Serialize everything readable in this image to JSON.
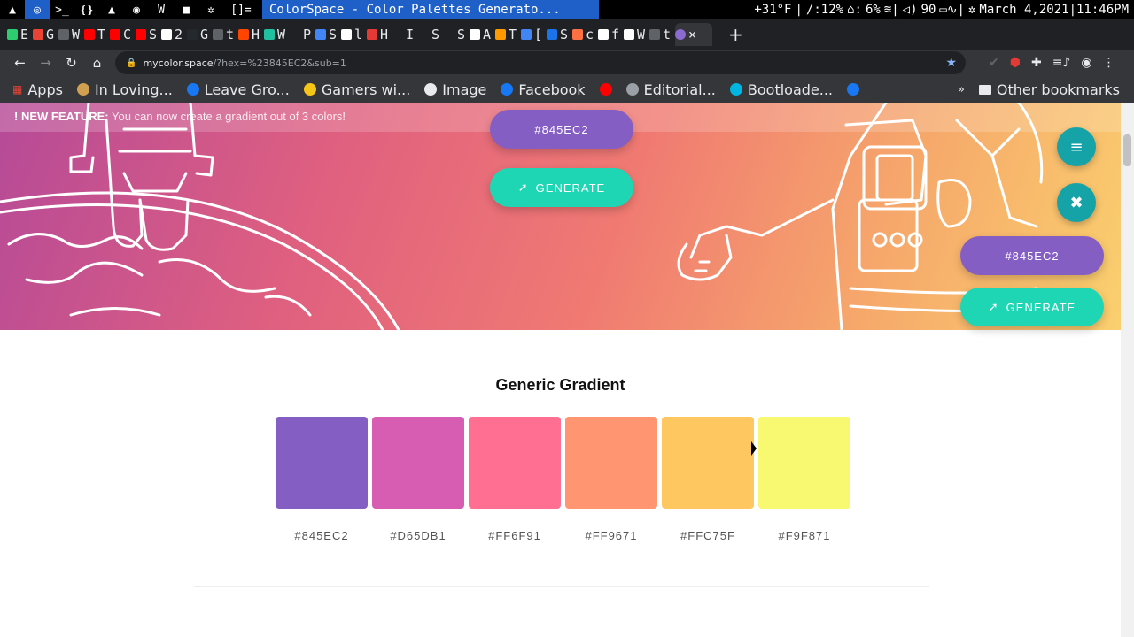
{
  "system_bar": {
    "window_title": "ColorSpace - Color Palettes Generato...",
    "workspace_label": "[]=",
    "temperature": "+31°F",
    "cpu": "/:12%",
    "home_disk": "6%",
    "volume": "90",
    "datetime": "March 4,2021|11:46PM"
  },
  "tabs": [
    {
      "letter": "E",
      "color": "#2ecc71"
    },
    {
      "letter": "G",
      "color": "#ea4335"
    },
    {
      "letter": "W",
      "color": "#5f6368"
    },
    {
      "letter": "T",
      "color": "#ff0000"
    },
    {
      "letter": "C",
      "color": "#ff0000"
    },
    {
      "letter": "S",
      "color": "#ff0000"
    },
    {
      "letter": "2",
      "color": "#ffffff"
    },
    {
      "letter": "G",
      "color": "#24292e"
    },
    {
      "letter": "t",
      "color": "#5f6368"
    },
    {
      "letter": "H",
      "color": "#ff4500"
    },
    {
      "letter": "W",
      "color": "#1fbfa0"
    },
    {
      "letter": "P",
      "color": "#202124"
    },
    {
      "letter": "S",
      "color": "#4285f4"
    },
    {
      "letter": "l",
      "color": "#ffffff"
    },
    {
      "letter": "H",
      "color": "#e53935"
    },
    {
      "letter": "I",
      "color": "#202124"
    },
    {
      "letter": "S",
      "color": "#202124"
    },
    {
      "letter": "S",
      "color": "#202124"
    },
    {
      "letter": "A",
      "color": "#ffffff"
    },
    {
      "letter": "T",
      "color": "#ff9900"
    },
    {
      "letter": "[",
      "color": "#4285f4"
    },
    {
      "letter": "S",
      "color": "#1a73e8"
    },
    {
      "letter": "c",
      "color": "#ff7043"
    },
    {
      "letter": "f",
      "color": "#ffffff"
    },
    {
      "letter": "W",
      "color": "#ffffff"
    },
    {
      "letter": "t",
      "color": "#5f6368"
    }
  ],
  "toolbar": {
    "url_host": "mycolor.space",
    "url_path": "/?hex=%23845EC2&sub=1"
  },
  "bookmarks": {
    "apps": "Apps",
    "items": [
      {
        "label": "In Loving...",
        "color": "#d0a050"
      },
      {
        "label": "Leave Gro...",
        "color": "#1877f2"
      },
      {
        "label": "Gamers wi...",
        "color": "#f5c518"
      },
      {
        "label": "Image",
        "color": "#e8eaed"
      },
      {
        "label": "Facebook",
        "color": "#1877f2"
      },
      {
        "label": "",
        "color": "#ff0000"
      },
      {
        "label": "Editorial...",
        "color": "#9aa0a6"
      },
      {
        "label": "Bootloade...",
        "color": "#00b5e2"
      },
      {
        "label": "",
        "color": "#1877f2"
      }
    ],
    "more": "»",
    "other": "Other bookmarks"
  },
  "page": {
    "banner_strong": "! NEW FEATURE:",
    "banner_text": " You can now create a gradient out of 3 colors!",
    "hex_value": "#845EC2",
    "generate_label": "GENERATE",
    "section_title": "Generic Gradient",
    "gradient": [
      {
        "hex": "#845EC2"
      },
      {
        "hex": "#D65DB1"
      },
      {
        "hex": "#FF6F91"
      },
      {
        "hex": "#FF9671"
      },
      {
        "hex": "#FFC75F"
      },
      {
        "hex": "#F9F871"
      }
    ]
  }
}
